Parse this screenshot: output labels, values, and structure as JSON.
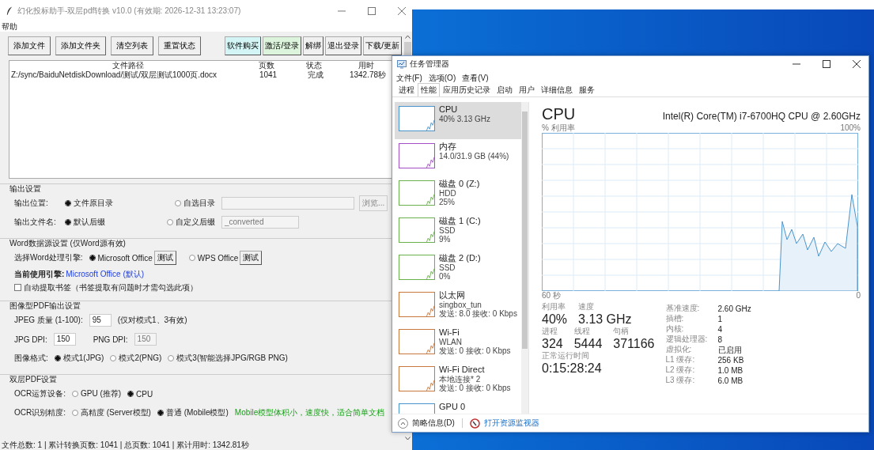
{
  "app_window": {
    "title": "幻化投标助手-双层pdf转换 v10.0 (有效期: 2026-12-31 13:23:07)",
    "menu": [
      "帮助"
    ],
    "toolbar_left": [
      "添加文件",
      "添加文件夹",
      "清空列表",
      "重置状态"
    ],
    "toolbar_right": [
      {
        "label": "软件购买",
        "color": "#d4f5f5"
      },
      {
        "label": "激活/登录",
        "color": "#dcf3dc"
      },
      {
        "label": "解绑",
        "color": "#f0f0f0"
      },
      {
        "label": "退出登录",
        "color": "#f0f0f0"
      },
      {
        "label": "下载/更新",
        "color": "#f0f0f0"
      }
    ],
    "table": {
      "columns": [
        "文件路径",
        "页数",
        "状态",
        "用时"
      ],
      "rows": [
        [
          "Z:/sync/BaiduNetdiskDownload/测试/双层测试1000页.docx",
          "1041",
          "完成",
          "1342.78秒"
        ]
      ]
    },
    "output_settings": {
      "title": "输出设置",
      "location": {
        "label": "输出位置:",
        "options": [
          {
            "label": "文件原目录",
            "selected": true
          },
          {
            "label": "自选目录",
            "selected": false
          }
        ],
        "browse_button": "浏览..."
      },
      "filename": {
        "label": "输出文件名:",
        "options": [
          {
            "label": "默认后缀",
            "selected": true
          },
          {
            "label": "自定义后缀",
            "selected": false
          }
        ],
        "suffix": "_converted"
      }
    },
    "word_settings": {
      "title": "Word数据源设置 (仅Word源有效)",
      "engine_label": "选择Word处理引擎:",
      "engines": [
        {
          "label": "Microsoft Office",
          "selected": true,
          "test_button": "测试"
        },
        {
          "label": "WPS Office",
          "selected": false,
          "test_button": "测试"
        }
      ],
      "current_label": "当前使用引擎:",
      "current_value": "Microsoft Office (默认)",
      "bookmark": {
        "label": "自动提取书签（书签提取有问题时才需勾选此项）",
        "checked": false
      }
    },
    "image_settings": {
      "title": "图像型PDF输出设置",
      "jpeg_quality": {
        "label": "JPEG 质量 (1-100):",
        "value": "95",
        "note": "(仅对模式1、3有效)"
      },
      "jpg_dpi": {
        "label": "JPG DPI:",
        "value": "150"
      },
      "png_dpi": {
        "label": "PNG DPI:",
        "value": "150",
        "disabled": true
      },
      "format": {
        "label": "图像格式:",
        "options": [
          {
            "label": "模式1(JPG)",
            "selected": true
          },
          {
            "label": "模式2(PNG)",
            "selected": false
          },
          {
            "label": "模式3(智能选择JPG/RGB PNG)",
            "selected": false
          }
        ]
      }
    },
    "ocr_settings": {
      "title": "双层PDF设置",
      "device": {
        "label": "OCR运算设备:",
        "options": [
          {
            "label": "GPU (推荐)",
            "selected": false
          },
          {
            "label": "CPU",
            "selected": true
          }
        ]
      },
      "precision": {
        "label": "OCR识别精度:",
        "options": [
          {
            "label": "高精度 (Server模型)",
            "selected": false
          },
          {
            "label": "普通 (Mobile模型)",
            "selected": true
          }
        ],
        "note": "Mobile模型体积小，速度快，适合简单文档"
      }
    },
    "status_bar": "文件总数: 1 | 累计转换页数: 1041 | 总页数: 1041 | 累计用时: 1342.81秒"
  },
  "task_manager": {
    "title": "任务管理器",
    "menu": [
      "文件(F)",
      "选项(O)",
      "查看(V)"
    ],
    "tabs": [
      {
        "label": "进程",
        "selected": false
      },
      {
        "label": "性能",
        "selected": true
      },
      {
        "label": "应用历史记录",
        "selected": false
      },
      {
        "label": "启动",
        "selected": false
      },
      {
        "label": "用户",
        "selected": false
      },
      {
        "label": "详细信息",
        "selected": false
      },
      {
        "label": "服务",
        "selected": false
      }
    ],
    "sidebar": [
      {
        "name": "CPU",
        "lines": [
          "40% 3.13 GHz"
        ],
        "color": "#4a94cc",
        "selected": true
      },
      {
        "name": "内存",
        "lines": [
          "14.0/31.9 GB (44%)"
        ],
        "color": "#a64fc4",
        "selected": false
      },
      {
        "name": "磁盘 0 (Z:)",
        "lines": [
          "HDD",
          "25%"
        ],
        "color": "#6ab04c",
        "selected": false
      },
      {
        "name": "磁盘 1 (C:)",
        "lines": [
          "SSD",
          "9%"
        ],
        "color": "#6ab04c",
        "selected": false
      },
      {
        "name": "磁盘 2 (D:)",
        "lines": [
          "SSD",
          "0%"
        ],
        "color": "#6ab04c",
        "selected": false
      },
      {
        "name": "以太网",
        "lines": [
          "singbox_tun",
          "发送: 8.0 接收: 0 Kbps"
        ],
        "color": "#c8783c",
        "selected": false
      },
      {
        "name": "Wi-Fi",
        "lines": [
          "WLAN",
          "发送: 0 接收: 0 Kbps"
        ],
        "color": "#c8783c",
        "selected": false
      },
      {
        "name": "Wi-Fi Direct",
        "lines": [
          "本地连接* 2",
          "发送: 0 接收: 0 Kbps"
        ],
        "color": "#c8783c",
        "selected": false
      },
      {
        "name": "GPU 0",
        "color": "#4a94cc",
        "selected": false
      }
    ],
    "detail": {
      "title": "CPU",
      "model": "Intel(R) Core(TM) i7-6700HQ CPU @ 2.60GHz",
      "graph_label": "% 利用率",
      "graph_max": "100%",
      "graph_span": "60 秒",
      "graph_min": "0",
      "stats": [
        {
          "label": "利用率",
          "value": "40%"
        },
        {
          "label": "速度",
          "value": "3.13 GHz"
        }
      ],
      "stats2": [
        {
          "label": "进程",
          "value": "324"
        },
        {
          "label": "线程",
          "value": "5444"
        },
        {
          "label": "句柄",
          "value": "371166"
        }
      ],
      "uptime": {
        "label": "正常运行时间",
        "value": "0:15:28:24"
      },
      "specs": [
        {
          "label": "基准速度:",
          "value": "2.60 GHz"
        },
        {
          "label": "插槽:",
          "value": "1"
        },
        {
          "label": "内核:",
          "value": "4"
        },
        {
          "label": "逻辑处理器:",
          "value": "8"
        },
        {
          "label": "虚拟化:",
          "value": "已启用"
        },
        {
          "label": "L1 缓存:",
          "value": "256 KB"
        },
        {
          "label": "L2 缓存:",
          "value": "1.0 MB"
        },
        {
          "label": "L3 缓存:",
          "value": "6.0 MB"
        }
      ]
    },
    "footer": {
      "summary": "简略信息(D)",
      "monitor": "打开资源监视器"
    }
  }
}
